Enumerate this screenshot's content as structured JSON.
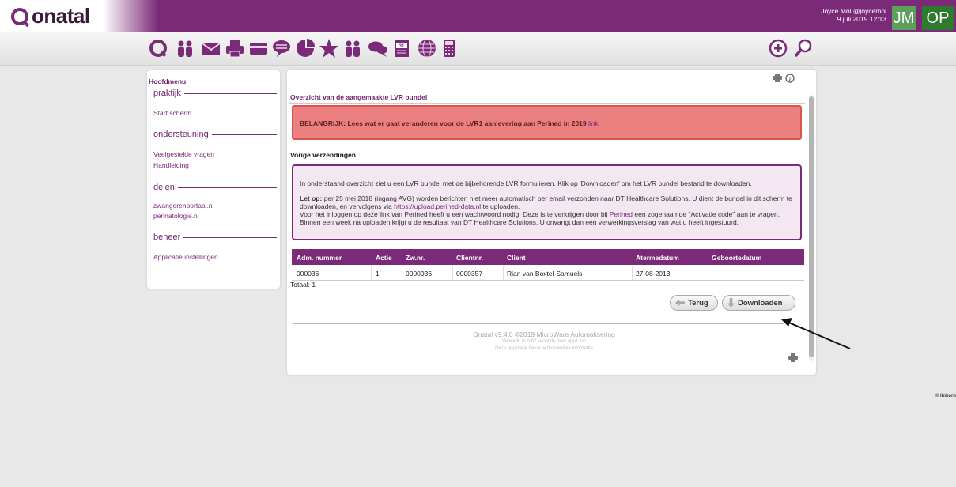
{
  "brand": {
    "name": "onatal"
  },
  "user": {
    "line1": "Joyce Mol @joycemol",
    "line2": "9 juli 2019 12:13",
    "badge1": "JM",
    "badge2": "OP"
  },
  "toolbar_icons": [
    "refresh-icon",
    "people-icon",
    "mail-icon",
    "print-icon",
    "card-icon",
    "speech-icon",
    "pie-chart-icon",
    "star-icon",
    "people-group-icon",
    "chat-icon",
    "calendar-icon",
    "globe-icon",
    "calculator-icon",
    "add-icon",
    "search-icon"
  ],
  "sidebar": {
    "title": "Hoofdmenu",
    "sections": [
      {
        "label": "praktijk",
        "items": [
          "Start scherm"
        ]
      },
      {
        "label": "ondersteuning",
        "items": [
          "Veelgestelde vragen",
          "Handleiding"
        ]
      },
      {
        "label": "delen",
        "items": [
          "zwangerenportaal.nl",
          "perinatologie.nl"
        ]
      },
      {
        "label": "beheer",
        "items": [
          "Applicatie instellingen"
        ]
      }
    ]
  },
  "main": {
    "title": "Overzicht van de aangemaakte LVR bundel",
    "alert": {
      "text": "BELANGRIJK: Lees wat er gaat veranderen voor de LVR1 aanlevering aan Perined in 2019",
      "link": "link"
    },
    "section_title": "Vorige verzendingen",
    "info": {
      "p1": "In onderstaand overzicht ziet u een LVR bundel met de bijbehorende LVR formulieren. Klik op 'Downloaden' om het LVR bundel bestand te downloaden.",
      "p2_bold": "Let op:",
      "p2_a": " per 25 mei 2018 (ingang AVG) worden berichten niet meer automatisch per email verzonden naar DT Healthcare Solutions. U dient de bundel in dit scherm te downloaden, en vervolgens via ",
      "p2_link": "https://upload.perined-data.nl",
      "p2_b": " te uploaden.",
      "p3_a": "Voor het inloggen op deze link van Perined heeft u een wachtwoord nodig. Deze is te verkrijgen door bij ",
      "p3_link": "Perined",
      "p3_b": " een zogenaamde \"Activatie code\" aan te vragen. Binnen een week na uploaden krijgt u de resultaat van DT Healthcare Solutions, U onvangt dan een verwerkingsverslag van wat u heeft ingestuurd."
    },
    "table": {
      "headers": [
        "Adm. nummer",
        "Actie",
        "Zw.nr.",
        "Clientnr.",
        "Client",
        "Atermedatum",
        "Geboortedatum"
      ],
      "rows": [
        [
          "000036",
          "1",
          "0000036",
          "0000357",
          "Rian van Boxtel-Samuels",
          "27-08-2013",
          ""
        ]
      ],
      "total": "Totaal: 1"
    },
    "buttons": {
      "back": "Terug",
      "download": "Downloaden"
    },
    "footer": {
      "line1": "Onatal v9.4.0 ©2019 MicroWare Automatisering",
      "line2": "Verwerkt in 0.62 seconde door app1:lon",
      "line3": "Deze applicatie bevat vertrouwelijke informatie"
    }
  },
  "watermark": "© linkorb"
}
